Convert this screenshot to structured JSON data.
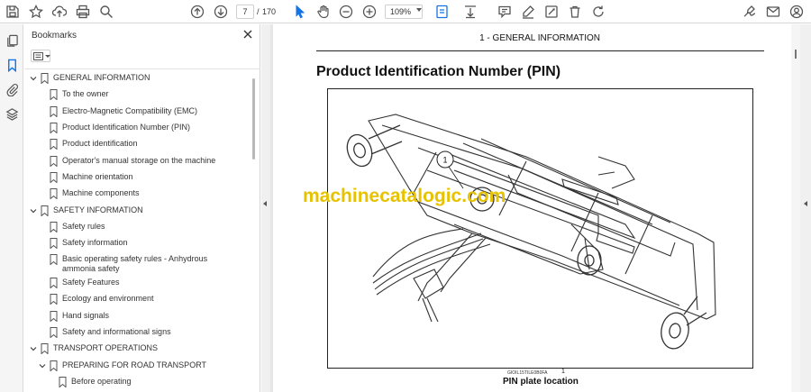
{
  "toolbar": {
    "current_page": "7",
    "page_separator": "/",
    "page_total": "170",
    "zoom": "109%"
  },
  "bookmarks": {
    "title": "Bookmarks",
    "items": [
      {
        "label": "GENERAL INFORMATION",
        "level": 0,
        "expandable": true
      },
      {
        "label": "To the owner",
        "level": 1
      },
      {
        "label": "Electro-Magnetic Compatibility (EMC)",
        "level": 1
      },
      {
        "label": "Product Identification Number (PIN)",
        "level": 1
      },
      {
        "label": "Product identification",
        "level": 1
      },
      {
        "label": "Operator's manual storage on the machine",
        "level": 1
      },
      {
        "label": "Machine orientation",
        "level": 1
      },
      {
        "label": "Machine components",
        "level": 1
      },
      {
        "label": "SAFETY INFORMATION",
        "level": 0,
        "expandable": true
      },
      {
        "label": "Safety rules",
        "level": 1
      },
      {
        "label": "Safety information",
        "level": 1
      },
      {
        "label": "Basic operating safety rules - Anhydrous ammonia safety",
        "level": 1
      },
      {
        "label": "Safety Features",
        "level": 1
      },
      {
        "label": "Ecology and environment",
        "level": 1
      },
      {
        "label": "Hand signals",
        "level": 1
      },
      {
        "label": "Safety and informational signs",
        "level": 1
      },
      {
        "label": "TRANSPORT OPERATIONS",
        "level": 0,
        "expandable": true
      },
      {
        "label": "PREPARING FOR ROAD TRANSPORT",
        "level": 1,
        "expandable": true
      },
      {
        "label": "Before operating",
        "level": 2
      }
    ]
  },
  "document": {
    "section_header": "1 - GENERAL INFORMATION",
    "heading": "Product Identification Number (PIN)",
    "figure_callout": "1",
    "figure_code": "GIOIL15TILE0B0FA",
    "figure_number": "1",
    "figure_caption": "PIN plate location",
    "watermark": "machinecatalogic.com"
  },
  "colors": {
    "accent": "#1473e6",
    "watermark": "#e6c200"
  }
}
